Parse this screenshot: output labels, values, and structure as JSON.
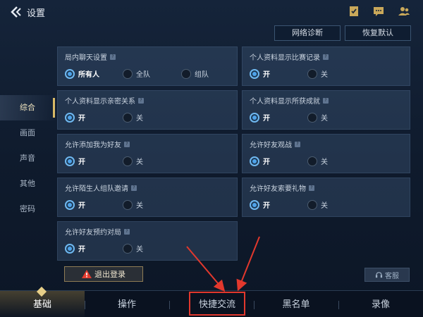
{
  "header": {
    "title": "设置",
    "icons": [
      "back-icon",
      "checklist-icon",
      "chat-icon",
      "friends-icon"
    ]
  },
  "actions": {
    "network": "网络诊断",
    "reset": "恢复默认"
  },
  "sidebar": {
    "items": [
      {
        "label": "综合",
        "active": true
      },
      {
        "label": "画面",
        "active": false
      },
      {
        "label": "声音",
        "active": false
      },
      {
        "label": "其他",
        "active": false
      },
      {
        "label": "密码",
        "active": false
      }
    ]
  },
  "settings": [
    {
      "title": "局内聊天设置",
      "options": [
        "所有人",
        "全队",
        "组队"
      ],
      "selected": 0
    },
    {
      "title": "个人资料显示比赛记录",
      "options": [
        "开",
        "关"
      ],
      "selected": 0
    },
    {
      "title": "个人资料显示亲密关系",
      "options": [
        "开",
        "关"
      ],
      "selected": 0
    },
    {
      "title": "个人资料显示所获成就",
      "options": [
        "开",
        "关"
      ],
      "selected": 0
    },
    {
      "title": "允许添加我为好友",
      "options": [
        "开",
        "关"
      ],
      "selected": 0
    },
    {
      "title": "允许好友观战",
      "options": [
        "开",
        "关"
      ],
      "selected": 0
    },
    {
      "title": "允许陌生人组队邀请",
      "options": [
        "开",
        "关"
      ],
      "selected": 0
    },
    {
      "title": "允许好友索要礼物",
      "options": [
        "开",
        "关"
      ],
      "selected": 0
    },
    {
      "title": "允许好友预约对局",
      "options": [
        "开",
        "关"
      ],
      "selected": 0
    }
  ],
  "logout": "退出登录",
  "support": "客服",
  "tabs": [
    {
      "label": "基础",
      "active": true
    },
    {
      "label": "操作",
      "active": false
    },
    {
      "label": "快捷交流",
      "active": false
    },
    {
      "label": "黑名单",
      "active": false
    },
    {
      "label": "录像",
      "active": false
    }
  ],
  "colors": {
    "accent": "#4fa3ea",
    "gold": "#d8b966",
    "annotation": "#e2382d"
  }
}
